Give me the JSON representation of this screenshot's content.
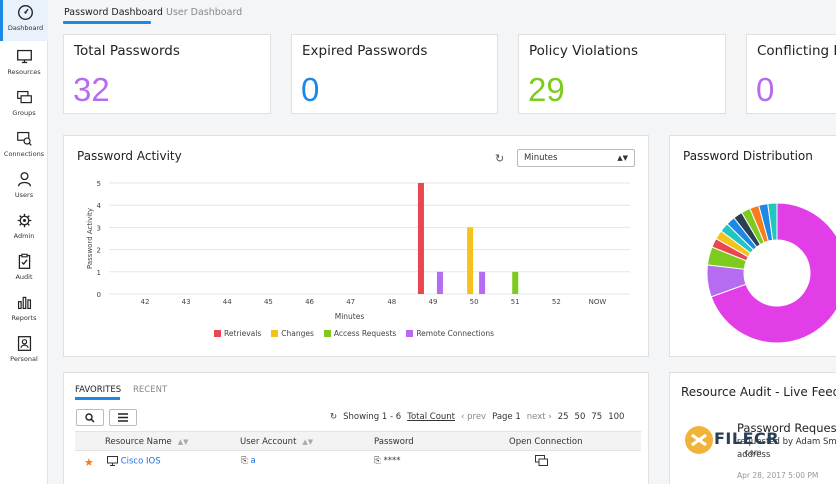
{
  "sidebar": {
    "items": [
      {
        "label": "Dashboard",
        "icon": "dashboard-icon",
        "active": true
      },
      {
        "label": "Resources",
        "icon": "monitor-icon"
      },
      {
        "label": "Groups",
        "icon": "groups-icon"
      },
      {
        "label": "Connections",
        "icon": "connections-icon"
      },
      {
        "label": "Users",
        "icon": "user-icon"
      },
      {
        "label": "Admin",
        "icon": "gear-icon"
      },
      {
        "label": "Audit",
        "icon": "clipboard-icon"
      },
      {
        "label": "Reports",
        "icon": "bar-chart-icon"
      },
      {
        "label": "Personal",
        "icon": "personal-icon"
      }
    ]
  },
  "tabs": {
    "password_dashboard": "Password Dashboard",
    "user_dashboard": "User Dashboard"
  },
  "stats": [
    {
      "title": "Total Passwords",
      "value": "32",
      "color": "#b56cf0"
    },
    {
      "title": "Expired Passwords",
      "value": "0",
      "color": "#1e88e5"
    },
    {
      "title": "Policy Violations",
      "value": "29",
      "color": "#7ecb20"
    },
    {
      "title": "Conflicting Pa",
      "value": "0",
      "color": "#b56cf0"
    }
  ],
  "activity": {
    "title": "Password Activity",
    "interval": "Minutes"
  },
  "chart_data": {
    "type": "bar",
    "title": "Password Activity",
    "xlabel": "Minutes",
    "ylabel": "Password Activity",
    "ylim": [
      0,
      5
    ],
    "yticks": [
      "0",
      "1",
      "2",
      "3",
      "4",
      "5"
    ],
    "categories": [
      "42",
      "43",
      "44",
      "45",
      "46",
      "47",
      "48",
      "49",
      "50",
      "51",
      "52",
      "NOW"
    ],
    "series": [
      {
        "name": "Retrievals",
        "color": "#e8474f",
        "values": [
          0,
          0,
          0,
          0,
          0,
          0,
          0,
          5,
          0,
          0,
          0,
          0
        ]
      },
      {
        "name": "Changes",
        "color": "#f5c21b",
        "values": [
          0,
          0,
          0,
          0,
          0,
          0,
          0,
          0,
          3,
          0,
          0,
          0
        ]
      },
      {
        "name": "Access Requests",
        "color": "#7ecb20",
        "values": [
          0,
          0,
          0,
          0,
          0,
          0,
          0,
          0,
          0,
          1,
          0,
          0
        ]
      },
      {
        "name": "Remote Connections",
        "color": "#b56cf0",
        "values": [
          0,
          0,
          0,
          0,
          0,
          0,
          0,
          1,
          1,
          0,
          0,
          0
        ]
      }
    ],
    "legend": "bottom",
    "grid": true
  },
  "distribution": {
    "title": "Password Distribution",
    "slices": [
      {
        "value": 66,
        "color": "#e23ee8"
      },
      {
        "value": 7,
        "color": "#b56cf0"
      },
      {
        "value": 4,
        "color": "#7ecb20"
      },
      {
        "value": 2,
        "color": "#e8474f"
      },
      {
        "value": 2,
        "color": "#f5c21b"
      },
      {
        "value": 2,
        "color": "#23c5c0"
      },
      {
        "value": 2,
        "color": "#1e88e5"
      },
      {
        "value": 2,
        "color": "#2a3f54"
      },
      {
        "value": 2,
        "color": "#7ecb20"
      },
      {
        "value": 2,
        "color": "#f57c1f"
      },
      {
        "value": 2,
        "color": "#1e88e5"
      },
      {
        "value": 2,
        "color": "#23c5c0"
      }
    ]
  },
  "favorites": {
    "tab_favorites": "FAVORITES",
    "tab_recent": "RECENT",
    "showing": "Showing 1 - 6",
    "total_count": "Total Count",
    "prev": "prev",
    "page": "Page 1",
    "next": "next",
    "page_sizes": [
      "25",
      "50",
      "75",
      "100"
    ],
    "columns": {
      "resource_name": "Resource Name",
      "user_account": "User Account",
      "password": "Password",
      "open_connection": "Open Connection"
    },
    "rows": [
      {
        "resource": "Cisco IOS",
        "account": "a",
        "password": "****"
      }
    ]
  },
  "audit": {
    "title": "Resource Audit - Live Feed",
    "item_title": "Password Request",
    "item_sub": "requested by Adam Smi",
    "item_sub2": "address",
    "item_date": "Apr 28, 2017 5:00 PM",
    "watermark": "FILECR",
    "watermark_sub": ".com"
  }
}
